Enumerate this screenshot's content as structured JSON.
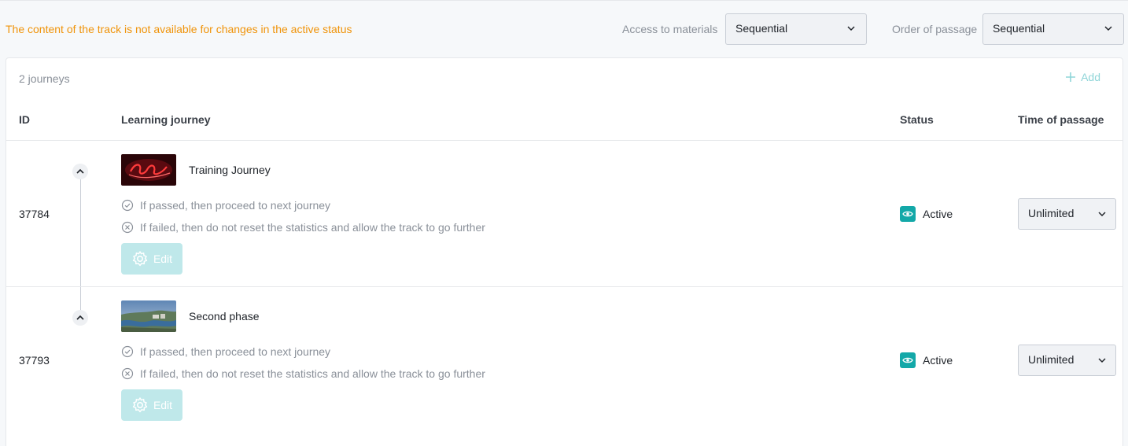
{
  "header": {
    "warning": "The content of the track is not available for changes in the active status",
    "access_label": "Access to materials",
    "access_value": "Sequential",
    "order_label": "Order of passage",
    "order_value": "Sequential"
  },
  "list": {
    "count": "2 journeys",
    "add_label": "Add",
    "columns": {
      "id": "ID",
      "journey": "Learning journey",
      "status": "Status",
      "time": "Time of passage"
    }
  },
  "rows": [
    {
      "id": "37784",
      "name": "Training Journey",
      "passed_rule": "If passed, then proceed to next journey",
      "failed_rule": "If failed, then do not reset the statistics and allow the track to go further",
      "edit_label": "Edit",
      "status": "Active",
      "time": "Unlimited"
    },
    {
      "id": "37793",
      "name": "Second phase",
      "passed_rule": "If passed, then proceed to next journey",
      "failed_rule": "If failed, then do not reset the statistics and allow the track to go further",
      "edit_label": "Edit",
      "status": "Active",
      "time": "Unlimited"
    }
  ],
  "colors": {
    "warning": "#f0940a",
    "accent": "#13a8a8",
    "accent_light": "#bfe8ea"
  },
  "icons": {
    "chevron": "chevron-down-icon",
    "collapse": "chevron-up-icon",
    "add": "plus-icon",
    "passed": "check-circle-icon",
    "failed": "x-circle-icon",
    "edit": "gear-icon",
    "status": "eye-icon"
  }
}
